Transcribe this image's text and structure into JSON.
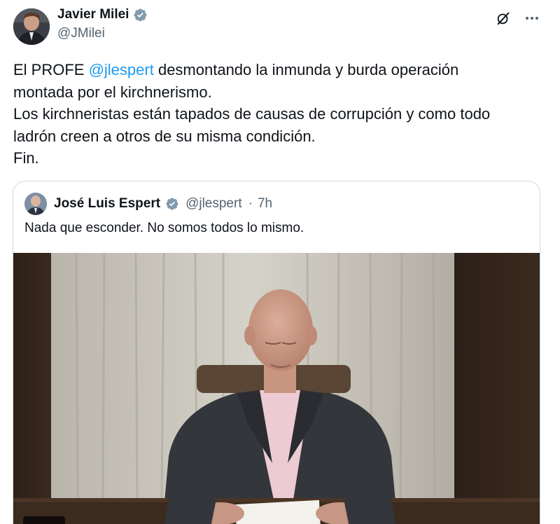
{
  "author": {
    "display_name": "Javier Milei",
    "handle": "@JMilei",
    "avatar_icon": "avatar-photo"
  },
  "tweet": {
    "lines": [
      {
        "before": "El PROFE ",
        "mention": "@jlespert",
        "after": " desmontando la inmunda y burda operación"
      },
      {
        "text": "montada por el kirchnerismo."
      },
      {
        "text": "Los kirchneristas están tapados de causas de corrupción y como todo"
      },
      {
        "text": "ladrón creen a otros de su misma condición."
      },
      {
        "text": "Fin."
      }
    ]
  },
  "quoted": {
    "display_name": "José Luis Espert",
    "handle": "@jlespert",
    "separator": "·",
    "time": "7h",
    "text": "Nada que esconder. No somos todos lo mismo.",
    "media_icon": "video-thumbnail"
  },
  "icons": {
    "verified": "verified-badge-icon",
    "grok": "grok-icon",
    "more": "more-icon"
  },
  "colors": {
    "accent": "#1d9bf0",
    "secondary_text": "#536471",
    "border": "#cfd9de"
  }
}
